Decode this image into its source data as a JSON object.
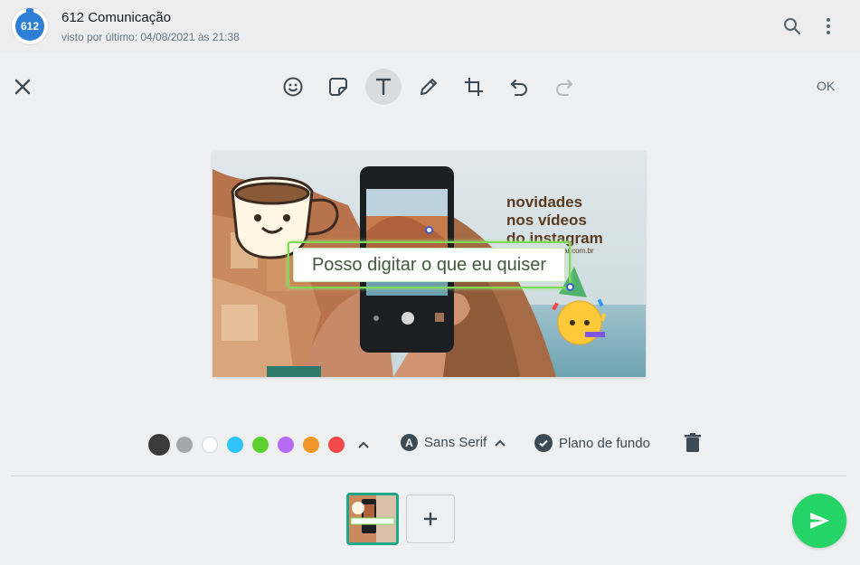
{
  "header": {
    "avatar_text": "612",
    "contact_name": "612 Comunicação",
    "status": "visto por último: 04/08/2021 às 21:38",
    "icons": [
      "search-icon",
      "menu-icon"
    ]
  },
  "toolbar": {
    "tools": [
      "emoji-icon",
      "sticker-icon",
      "text-icon",
      "pencil-icon",
      "crop-icon",
      "undo-icon",
      "redo-icon"
    ],
    "active_tool": "text-icon",
    "ok_label": "OK"
  },
  "canvas": {
    "promo_line1": "novidades",
    "promo_line2": "nos vídeos",
    "promo_line3": "do instagram",
    "promo_url": "eviar.com.br",
    "text_overlay": "Posso digitar o que eu quiser"
  },
  "palette": {
    "colors": [
      "#3b3b3b",
      "#a4a7ab",
      "#ffffff",
      "#30c5f6",
      "#5cd02f",
      "#b56bf5",
      "#f4952a",
      "#f24a4a"
    ],
    "selected_index": 0
  },
  "text_options": {
    "font_badge": "A",
    "font_label": "Sans Serif",
    "background_label": "Plano de fundo"
  },
  "accent_color": "#25d366"
}
